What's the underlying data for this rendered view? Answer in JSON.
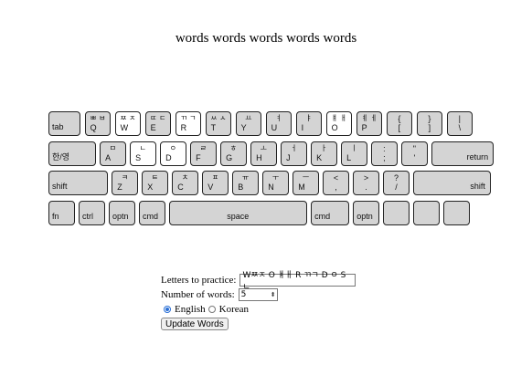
{
  "page": {
    "title": "words words words words words"
  },
  "keyboard": {
    "rows": [
      [
        {
          "en": "tab"
        },
        {
          "en": "Q",
          "ko": "ㅃ ㅂ"
        },
        {
          "en": "W",
          "ko": "ㅉ ㅈ",
          "hl": true
        },
        {
          "en": "E",
          "ko": "ㄸ ㄷ"
        },
        {
          "en": "R",
          "ko": "ㄲ ㄱ",
          "hl": true
        },
        {
          "en": "T",
          "ko": "ㅆ ㅅ"
        },
        {
          "en": "Y",
          "ko": "ㅛ"
        },
        {
          "en": "U",
          "ko": "ㅕ"
        },
        {
          "en": "I",
          "ko": "ㅑ"
        },
        {
          "en": "O",
          "ko": "ㅒ ㅐ",
          "hl": true
        },
        {
          "en": "P",
          "ko": "ㅖ ㅔ"
        },
        {
          "en": "[",
          "top": "{"
        },
        {
          "en": "]",
          "top": "}"
        },
        {
          "en": "\\",
          "top": "|"
        }
      ],
      [
        {
          "en": "한/영"
        },
        {
          "en": "A",
          "ko": "ㅁ"
        },
        {
          "en": "S",
          "ko": "ㄴ",
          "hl": true
        },
        {
          "en": "D",
          "ko": "ㅇ",
          "hl": true
        },
        {
          "en": "F",
          "ko": "ㄹ"
        },
        {
          "en": "G",
          "ko": "ㅎ"
        },
        {
          "en": "H",
          "ko": "ㅗ"
        },
        {
          "en": "J",
          "ko": "ㅓ"
        },
        {
          "en": "K",
          "ko": "ㅏ"
        },
        {
          "en": "L",
          "ko": "ㅣ"
        },
        {
          "en": ";",
          "top": ":"
        },
        {
          "en": "'",
          "top": "\""
        },
        {
          "en": "return"
        }
      ],
      [
        {
          "en": "shift"
        },
        {
          "en": "Z",
          "ko": "ㅋ"
        },
        {
          "en": "X",
          "ko": "ㅌ"
        },
        {
          "en": "C",
          "ko": "ㅊ"
        },
        {
          "en": "V",
          "ko": "ㅍ"
        },
        {
          "en": "B",
          "ko": "ㅠ"
        },
        {
          "en": "N",
          "ko": "ㅜ"
        },
        {
          "en": "M",
          "ko": "ㅡ"
        },
        {
          "en": ",",
          "top": "<"
        },
        {
          "en": ".",
          "top": ">"
        },
        {
          "en": "/",
          "top": "?"
        },
        {
          "en": "shift"
        }
      ],
      [
        {
          "en": "fn"
        },
        {
          "en": "ctrl"
        },
        {
          "en": "optn"
        },
        {
          "en": "cmd"
        },
        {
          "en": "space"
        },
        {
          "en": "cmd"
        },
        {
          "en": "optn"
        },
        {
          "en": ""
        },
        {
          "en": ""
        },
        {
          "en": ""
        }
      ]
    ]
  },
  "controls": {
    "letters_label": "Letters to practice:",
    "letters_value": "Wㅉㅈ O ㅒㅐ R ㄲㄱ D ㅇ S ㄴ",
    "words_label": "Number of words:",
    "words_value": "5",
    "english_label": "English",
    "korean_label": "Korean",
    "selected_language": "English",
    "update_button": "Update Words",
    "accent_color": "#2a6fd6"
  }
}
